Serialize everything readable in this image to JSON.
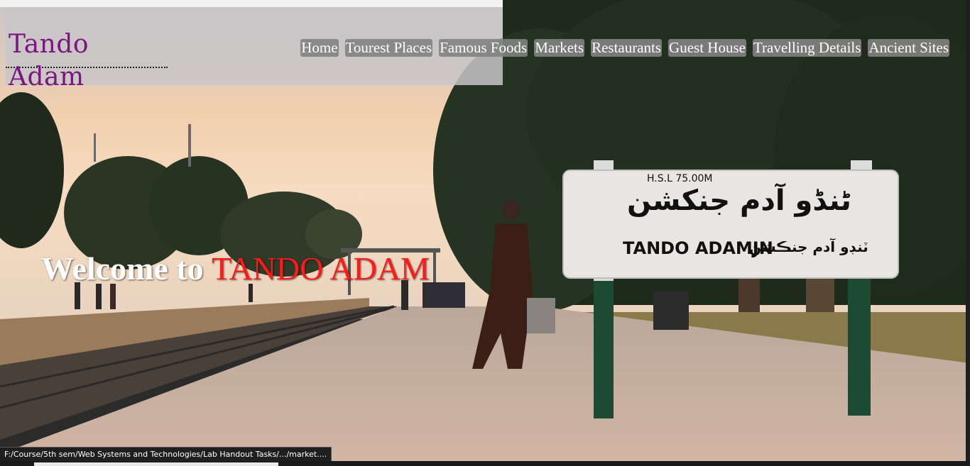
{
  "site": {
    "logo_text": "Tando Adam"
  },
  "nav": {
    "items": [
      {
        "label": "Home"
      },
      {
        "label": "Tourest Places"
      },
      {
        "label": "Famous Foods"
      },
      {
        "label": "Markets"
      },
      {
        "label": "Restaurants"
      },
      {
        "label": "Guest House"
      },
      {
        "label": "Travelling Details"
      },
      {
        "label": "Ancient Sites"
      }
    ]
  },
  "hero": {
    "welcome_prefix": "Welcome to ",
    "welcome_highlight": "TANDO ADAM",
    "sign_top": "H.S.L 75.00M",
    "sign_urdu": "ٹنڈو آدم جنکشن",
    "sign_latin": "TANDO ADAMJN",
    "sign_sindhi": "ٽنڊو آدم جنڪشن"
  },
  "status_bar": {
    "link_preview": "F:/Course/5th sem/Web Systems and Technologies/Lab Handout Tasks/.../market...."
  },
  "colors": {
    "logo": "#7b1680",
    "highlight": "#ff1a1a",
    "nav_bg": "#828282",
    "header_bg": "#c8c6c8"
  }
}
